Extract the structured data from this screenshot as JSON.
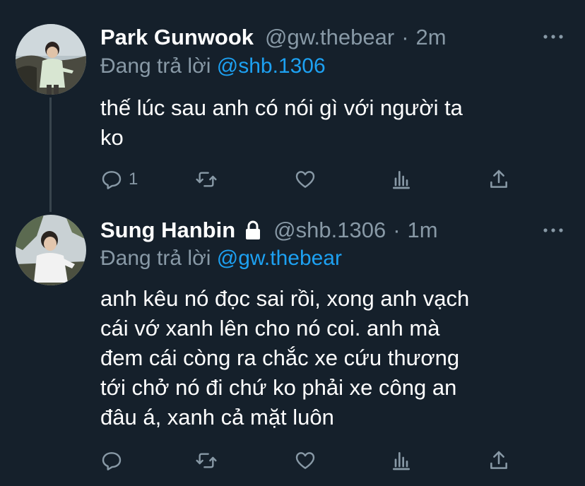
{
  "tweets": [
    {
      "display_name": "Park Gunwook",
      "handle": "@gw.thebear",
      "separator": "·",
      "time": "2m",
      "reply_prefix": "Đang trả lời",
      "reply_to": "@shb.1306",
      "text_lines": [
        "thế lúc sau anh có nói gì với người ta",
        "ko"
      ],
      "reply_count": "1",
      "locked": false
    },
    {
      "display_name": "Sung Hanbin",
      "handle": "@shb.1306",
      "separator": "·",
      "time": "1m",
      "reply_prefix": "Đang trả lời",
      "reply_to": "@gw.thebear",
      "text_lines": [
        "anh kêu nó đọc sai rồi, xong anh vạch",
        "cái vớ xanh lên cho nó coi. anh mà",
        "đem cái còng ra chắc xe cứu thương",
        "tới chở nó đi chứ ko phải xe công an",
        "đâu á, xanh cả mặt luôn"
      ],
      "reply_count": "",
      "locked": true
    }
  ],
  "colors": {
    "background": "#15202b",
    "secondary_text": "#8899a6",
    "mention": "#1da1f2",
    "thread_line": "#38444d"
  },
  "icons": [
    "reply-icon",
    "retweet-icon",
    "like-icon",
    "stats-icon",
    "share-icon",
    "more-icon",
    "lock-icon"
  ]
}
